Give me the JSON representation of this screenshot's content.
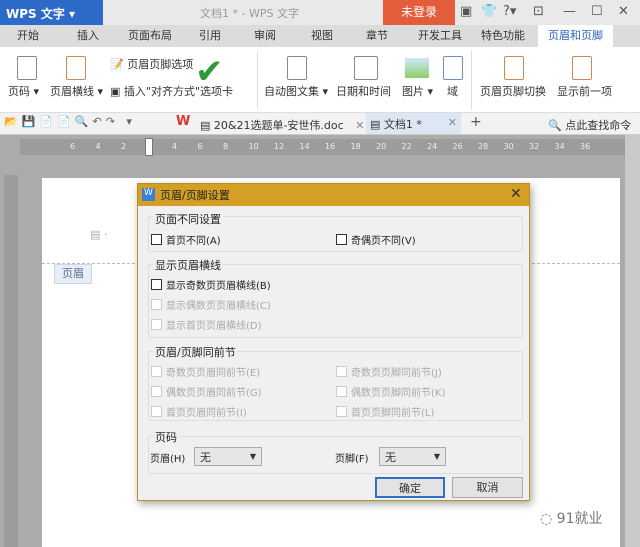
{
  "app": {
    "logo": "WPS 文字",
    "title": "文档1 * - WPS 文字",
    "login": "未登录"
  },
  "tabs": [
    "开始",
    "插入",
    "页面布局",
    "引用",
    "审阅",
    "视图",
    "章节",
    "开发工具",
    "特色功能",
    "页眉和页脚"
  ],
  "ribbon": {
    "page_num": "页码",
    "header_line": "页眉横线",
    "hf_options": "页眉页脚选项",
    "insert_align": "插入\"对齐方式\"选项卡",
    "autotext": "自动图文集",
    "datetime": "日期和时间",
    "picture": "图片",
    "field": "域",
    "hf_switch": "页眉页脚切换",
    "show_prev": "显示前一项"
  },
  "docs": {
    "tab1": "20&21选题单-安世伟.doc",
    "tab2": "文档1 *",
    "search": "点此查找命令"
  },
  "ruler": [
    "6",
    "4",
    "2",
    "2",
    "4",
    "6",
    "8",
    "10",
    "12",
    "14",
    "16",
    "18",
    "20",
    "22",
    "24",
    "26",
    "28",
    "30",
    "32",
    "34",
    "36"
  ],
  "page": {
    "header_tag": "页眉"
  },
  "dialog": {
    "title": "页眉/页脚设置",
    "g1": {
      "label": "页面不同设置",
      "first": "首页不同(A)",
      "oddeven": "奇偶页不同(V)"
    },
    "g2": {
      "label": "显示页眉横线",
      "odd": "显示奇数页页眉横线(B)",
      "even": "显示偶数页页眉横线(C)",
      "first": "显示首页页眉横线(D)"
    },
    "g3": {
      "label": "页眉/页脚同前节",
      "a": "奇数页页眉同前节(E)",
      "b": "奇数页页脚同前节(J)",
      "c": "偶数页页眉同前节(G)",
      "d": "偶数页页脚同前节(K)",
      "e": "首页页眉同前节(I)",
      "f": "首页页脚同前节(L)"
    },
    "g4": {
      "label": "页码",
      "header_label": "页眉(H)",
      "header_value": "无",
      "footer_label": "页脚(F)",
      "footer_value": "无"
    },
    "ok": "确定",
    "cancel": "取消"
  },
  "watermark": "91就业"
}
